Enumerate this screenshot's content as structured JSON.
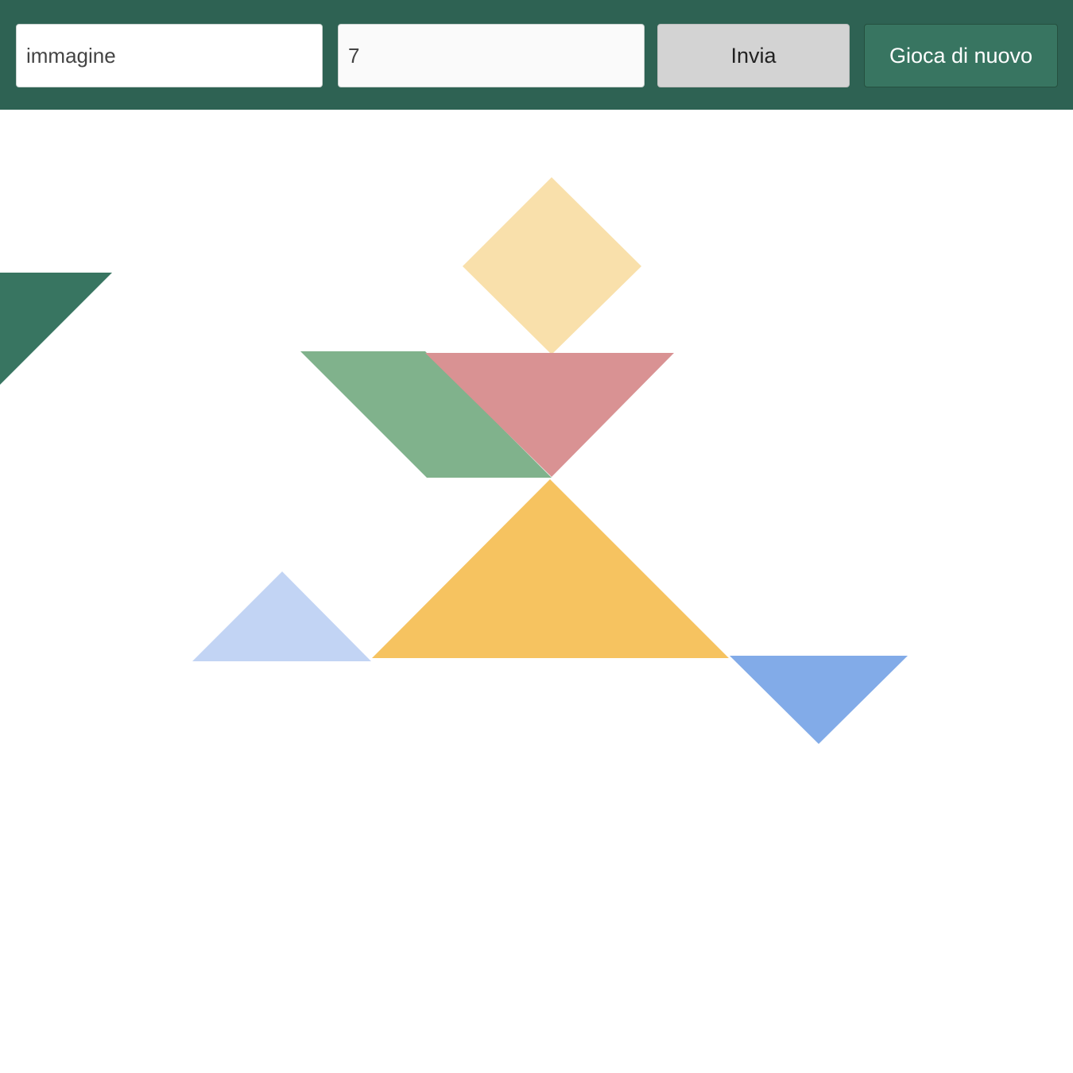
{
  "toolbar": {
    "word_input": {
      "placeholder": "immagine",
      "value": ""
    },
    "number_input": {
      "placeholder": "7",
      "value": ""
    },
    "send_label": "Invia",
    "replay_label": "Gioca di nuovo",
    "background_color": "#2e6253"
  },
  "board": {
    "pieces": [
      {
        "name": "dark-green-triangle",
        "shape": "triangle",
        "color": "#387561"
      },
      {
        "name": "pale-yellow-square",
        "shape": "square",
        "color": "#f9e0ab"
      },
      {
        "name": "green-parallelogram",
        "shape": "parallelogram",
        "color": "#80b28c"
      },
      {
        "name": "pink-triangle",
        "shape": "triangle",
        "color": "#d99293"
      },
      {
        "name": "orange-triangle",
        "shape": "triangle",
        "color": "#f6c360"
      },
      {
        "name": "light-blue-triangle",
        "shape": "triangle",
        "color": "#c2d4f4"
      },
      {
        "name": "blue-triangle",
        "shape": "triangle",
        "color": "#82abe8"
      }
    ]
  }
}
